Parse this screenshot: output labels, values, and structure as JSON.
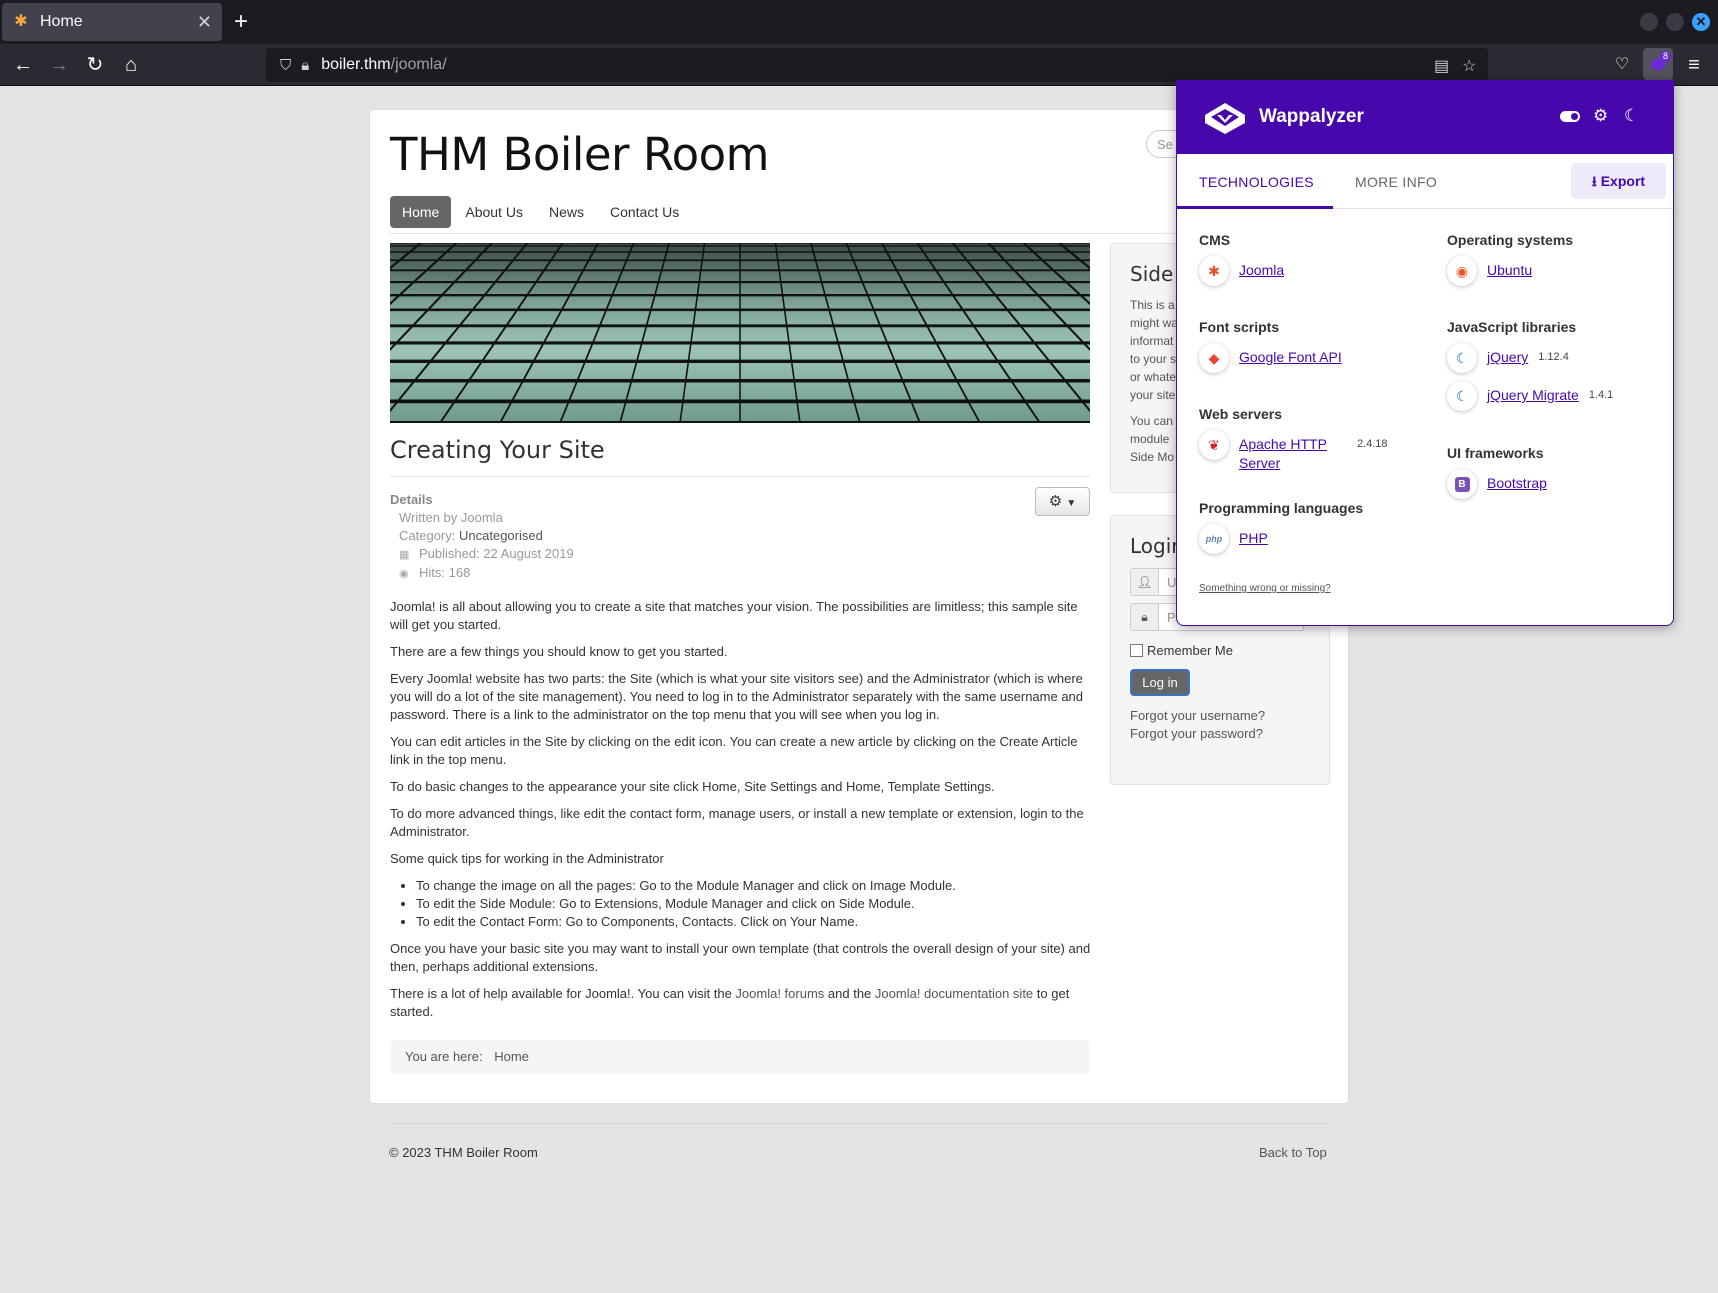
{
  "browser": {
    "tab_title": "Home",
    "url_host": "boiler.thm",
    "url_path": "/joomla/",
    "extension_badge": "8"
  },
  "site": {
    "title": "THM Boiler Room",
    "search_placeholder": "Se",
    "menu": [
      {
        "label": "Home"
      },
      {
        "label": "About Us"
      },
      {
        "label": "News"
      },
      {
        "label": "Contact Us"
      }
    ]
  },
  "article": {
    "title": "Creating Your Site",
    "details_label": "Details",
    "written_by": "Written by Joomla",
    "category_label": "Category:",
    "category_value": "Uncategorised",
    "published": "Published: 22 August 2019",
    "hits": "Hits: 168",
    "paragraphs": [
      "Joomla! is all about allowing you to create a site that matches your vision. The possibilities are limitless; this sample site will get you started.",
      "There are a few things you should know to get you started.",
      "Every Joomla! website has two parts: the Site (which is what your site visitors see) and the Administrator (which is where you will do a lot of the site management). You need to log in to the Administrator separately with the same username and password. There is a link to the administrator on the top menu that you will see when you log in.",
      "You can edit articles in the Site by clicking on the edit icon. You can create a new article by clicking on the Create Article link in the top menu.",
      "To do basic changes to the appearance your site click Home, Site Settings and Home, Template Settings.",
      "To do more advanced things, like edit the contact form, manage users, or install a new template or extension, login to the Administrator.",
      "Some quick tips for working in the Administrator"
    ],
    "tips": [
      "To change the image on all the pages: Go to the Module Manager and click on Image Module.",
      "To edit the Side Module: Go to Extensions, Module Manager and click on Side Module.",
      "To edit the Contact Form: Go to Components, Contacts. Click on Your Name."
    ],
    "after_tips": "Once you have your basic site you may want to install your own template (that controls the overall design of your site) and then, perhaps additional extensions.",
    "help_pre": "There is a lot of help available for Joomla!. You can visit the ",
    "help_link1": "Joomla! forums",
    "help_mid": " and the ",
    "help_link2": "Joomla! documentation site",
    "help_post": " to get started."
  },
  "breadcrumb": {
    "label": "You are here:",
    "current": "Home"
  },
  "side_module": {
    "title": "Side M",
    "lines": [
      "This is a",
      "might wa",
      "informat",
      "to your s",
      "or whate",
      "your site"
    ],
    "lines2": [
      "You can",
      "module",
      "Side Mo"
    ]
  },
  "login": {
    "title": "Login",
    "username_placeholder": "U",
    "password_placeholder": "P",
    "remember_label": "Remember Me",
    "button_label": "Log in",
    "forgot_username": "Forgot your username?",
    "forgot_password": "Forgot your password?"
  },
  "footer": {
    "copyright": "© 2023 THM Boiler Room",
    "back_to_top": "Back to Top"
  },
  "wappalyzer": {
    "brand": "Wappalyzer",
    "tabs": [
      "TECHNOLOGIES",
      "MORE INFO"
    ],
    "export_label": "Export",
    "categories": {
      "cms": {
        "title": "CMS",
        "tech": {
          "name": "Joomla",
          "icon": "joomla-icon",
          "color": "#e44d26"
        }
      },
      "font_scripts": {
        "title": "Font scripts",
        "tech": {
          "name": "Google Font API",
          "icon": "google-font-icon",
          "color": "#4285f4"
        }
      },
      "web_servers": {
        "title": "Web servers",
        "tech": {
          "name_line1": "Apache HTTP",
          "name_line2": "Server",
          "version": "2.4.18",
          "icon": "apache-feather-icon",
          "color": "#d22128"
        }
      },
      "programming": {
        "title": "Programming languages",
        "tech": {
          "name": "PHP",
          "icon": "php-icon",
          "color": "#6181b6"
        }
      },
      "os": {
        "title": "Operating systems",
        "tech": {
          "name": "Ubuntu",
          "icon": "ubuntu-icon",
          "color": "#e95420"
        }
      },
      "js_libs": {
        "title": "JavaScript libraries",
        "techs": [
          {
            "name": "jQuery",
            "version": "1.12.4",
            "icon": "jquery-icon",
            "color": "#0769ad"
          },
          {
            "name": "jQuery Migrate",
            "version": "1.4.1",
            "icon": "jquery-migrate-icon",
            "color": "#0769ad"
          }
        ]
      },
      "ui": {
        "title": "UI frameworks",
        "tech": {
          "name": "Bootstrap",
          "icon": "bootstrap-icon",
          "color": "#7952b3"
        }
      }
    },
    "footer_link": "Something wrong or missing?"
  }
}
